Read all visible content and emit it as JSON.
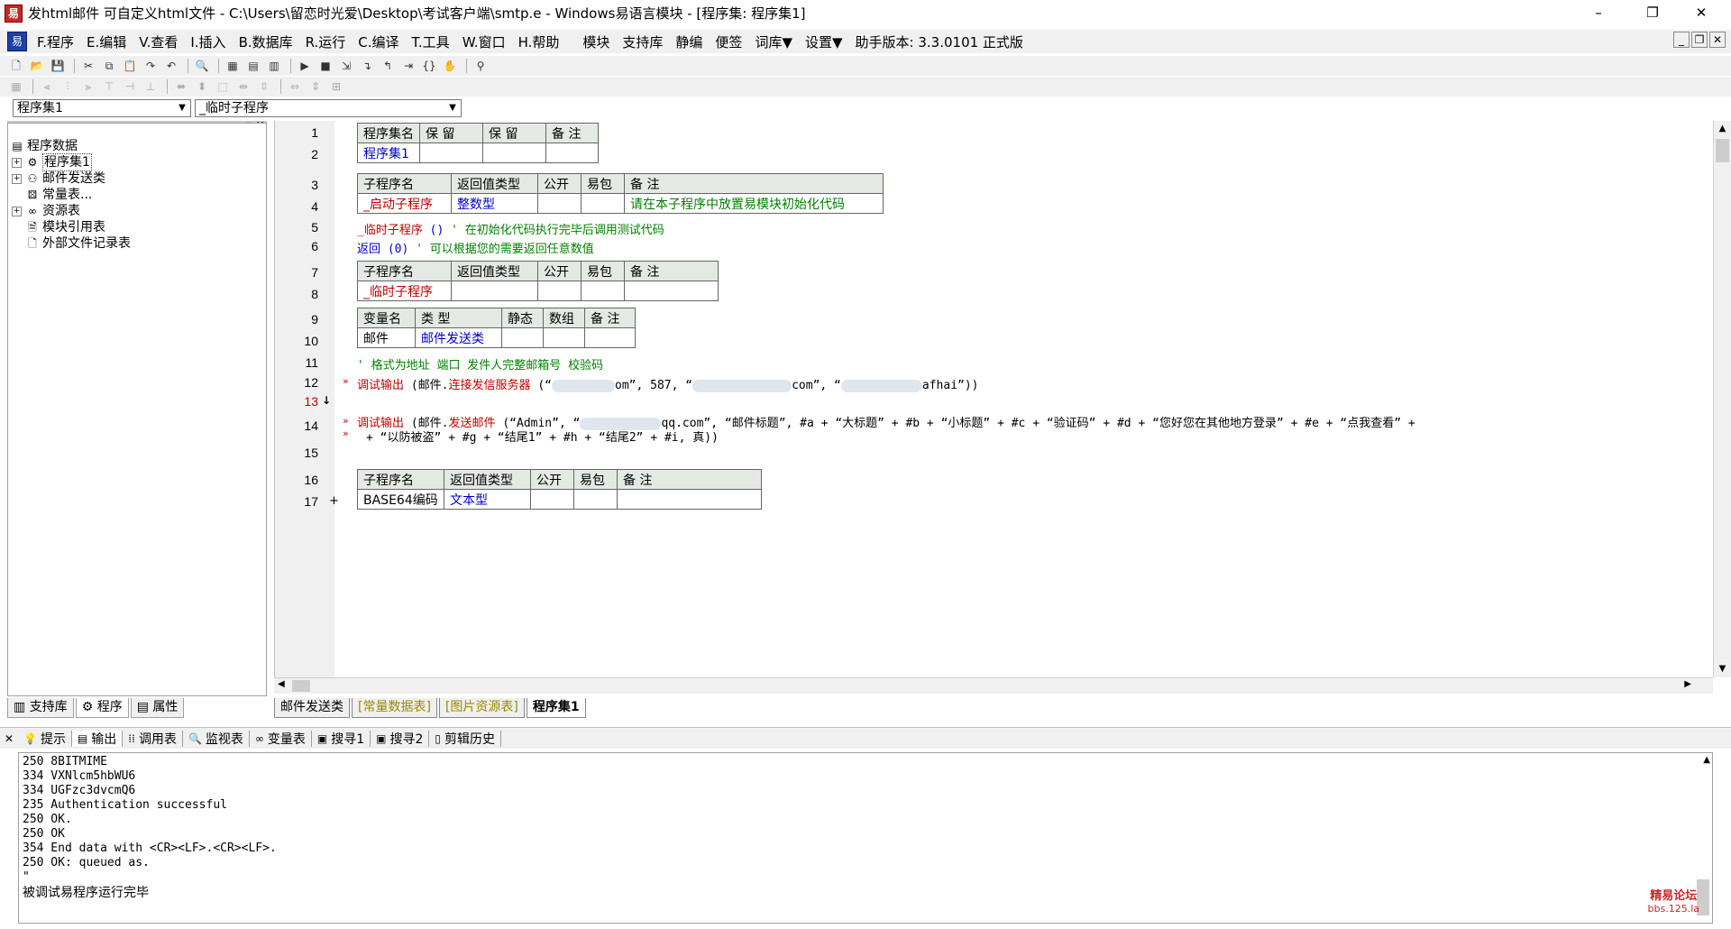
{
  "window": {
    "title": "发html邮件 可自定义html文件 - C:\\Users\\留恋时光爱\\Desktop\\考试客户端\\smtp.e - Windows易语言模块 - [程序集: 程序集1]",
    "minimize": "–",
    "maximize": "❐",
    "close": "✕"
  },
  "menu": {
    "items": [
      "F.程序",
      "E.编辑",
      "V.查看",
      "I.插入",
      "B.数据库",
      "R.运行",
      "C.编译",
      "T.工具",
      "W.窗口",
      "H.帮助",
      "模块",
      "支持库",
      "静编",
      "便签",
      "词库▼",
      "设置▼",
      "助手版本: 3.3.0101 正式版"
    ],
    "mdi_min": "_",
    "mdi_restore": "❐",
    "mdi_close": "✕"
  },
  "combos": {
    "assembly": "程序集1",
    "subprogram": "_临时子程序"
  },
  "tree": {
    "root": "程序数据",
    "items": [
      "程序集1",
      "邮件发送类",
      "常量表...",
      "资源表",
      "模块引用表",
      "外部文件记录表"
    ]
  },
  "left_tabs": [
    "支持库",
    "程序",
    "属性"
  ],
  "line_numbers": [
    "1",
    "2",
    "3",
    "4",
    "5",
    "6",
    "7",
    "8",
    "9",
    "10",
    "11",
    "12",
    "13",
    "14",
    "15",
    "16",
    "17"
  ],
  "assembly_table": {
    "headers": [
      "程序集名",
      "保 留",
      "保 留",
      "备 注"
    ],
    "row": [
      "程序集1",
      "",
      "",
      ""
    ]
  },
  "start_sub_table": {
    "headers": [
      "子程序名",
      "返回值类型",
      "公开",
      "易包",
      "备 注"
    ],
    "row": [
      "_启动子程序",
      "整数型",
      "",
      "",
      "请在本子程序中放置易模块初始化代码"
    ]
  },
  "code": {
    "line5_name": "_临时子程序",
    "line5_args": " ()",
    "line5_comment": "  ' 在初始化代码执行完毕后调用测试代码",
    "line6_kw": "返回",
    "line6_args": " (0)",
    "line6_comment": "  ' 可以根据您的需要返回任意数值",
    "line11_comment": "' 格式为地址  端口  发件人完整邮箱号  校验码",
    "line12_a": "调试输出",
    "line12_b": " (邮件.",
    "line12_c": "连接发信服务器",
    "line12_d": " (“",
    "line12_e": "om”, 587, “",
    "line12_f": "com”, “",
    "line12_g": "afhai”))",
    "line14_a": "调试输出",
    "line14_b": " (邮件.",
    "line14_c": "发送邮件",
    "line14_d": " (“Admin”, “",
    "line14_e": "qq.com”, “邮件标题”, #a + “大标题” + #b + “小标题” + #c + “验证码” + #d + “您好您在其他地方登录” + #e + “点我查看” +",
    "line14_f": "+ “以防被盗” + #g + “结尾1” + #h + “结尾2” + #i, 真))"
  },
  "temp_sub_table": {
    "headers": [
      "子程序名",
      "返回值类型",
      "公开",
      "易包",
      "备 注"
    ],
    "row": [
      "_临时子程序",
      "",
      "",
      "",
      ""
    ]
  },
  "var_table": {
    "headers": [
      "变量名",
      "类 型",
      "静态",
      "数组",
      "备 注"
    ],
    "row": [
      "邮件",
      "邮件发送类",
      "",
      "",
      ""
    ]
  },
  "base64_table": {
    "headers": [
      "子程序名",
      "返回值类型",
      "公开",
      "易包",
      "备 注"
    ],
    "row": [
      "BASE64编码",
      "文本型",
      "",
      "",
      ""
    ]
  },
  "editor_tabs": [
    "邮件发送类",
    "[常量数据表]",
    "[图片资源表]",
    "程序集1"
  ],
  "output_tabs": [
    "提示",
    "输出",
    "调用表",
    "监视表",
    "变量表",
    "搜寻1",
    "搜寻2",
    "剪辑历史"
  ],
  "output_lines": [
    "250 8BITMIME",
    "334 VXNlcm5hbWU6",
    "334 UGFzc3dvcmQ6",
    "235 Authentication successful",
    "250 OK.",
    "250 OK",
    "354 End data with <CR><LF>.<CR><LF>.",
    "250 OK: queued as.",
    "\"",
    "被调试易程序运行完毕"
  ],
  "watermark": {
    "line1": "精易论坛",
    "line2": "bbs.125.la"
  }
}
